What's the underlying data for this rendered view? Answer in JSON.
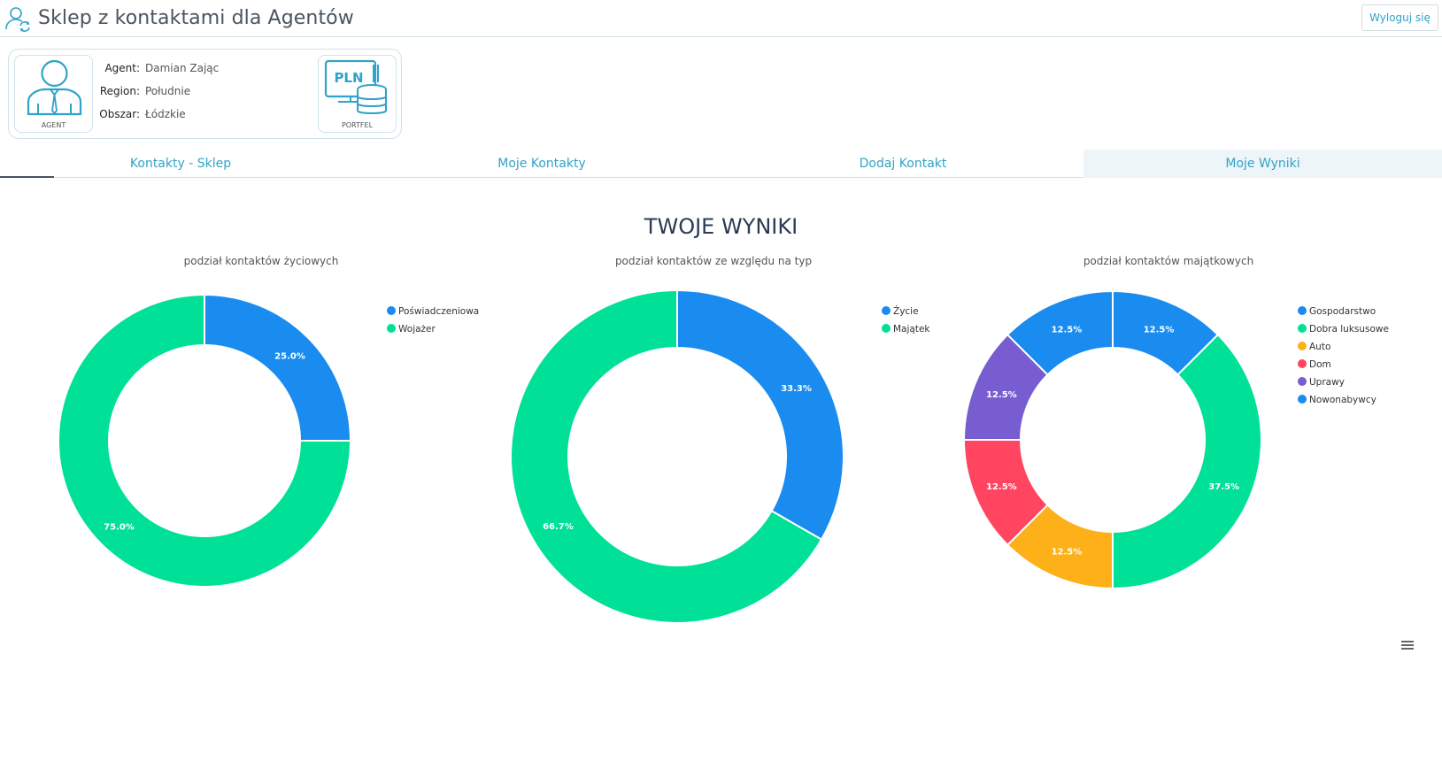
{
  "header": {
    "title": "Sklep z kontaktami dla Agentów",
    "logout_label": "Wyloguj się",
    "logo_icon": "user-sync-icon"
  },
  "agent_card": {
    "agent_tile_label": "AGENT",
    "wallet_tile_label": "PORTFEL",
    "wallet_currency": "PLN",
    "agent_icon": "person-icon",
    "wallet_icon": "wallet-coins-icon",
    "rows": [
      {
        "label": "Agent:",
        "value": "Damian Zając"
      },
      {
        "label": "Region:",
        "value": "Południe"
      },
      {
        "label": "Obszar:",
        "value": "Łódzkie"
      }
    ]
  },
  "tabs": [
    {
      "label": "Kontakty - Sklep",
      "active": false
    },
    {
      "label": "Moje Kontakty",
      "active": false
    },
    {
      "label": "Dodaj Kontakt",
      "active": false
    },
    {
      "label": "Moje Wyniki",
      "active": true
    }
  ],
  "section_title": "TWOJE WYNIKI",
  "menu_icon": "hamburger-menu-icon",
  "colors": {
    "accent": "#2fa3c9",
    "blue": "#1a8cf0",
    "green": "#00e096",
    "orange": "#feb019",
    "red": "#ff4560",
    "purple": "#775dd0"
  },
  "chart_data": [
    {
      "type": "pie",
      "variant": "donut",
      "title": "podział kontaktów życiowych",
      "categories": [
        "Poświadczeniowa",
        "Wojażer"
      ],
      "values": [
        25.0,
        75.0
      ],
      "labels": [
        "25.0%",
        "75.0%"
      ],
      "colors": [
        "#1a8cf0",
        "#00e096"
      ],
      "legend": "top-right"
    },
    {
      "type": "pie",
      "variant": "donut",
      "title": "podział kontaktów ze względu na typ",
      "categories": [
        "Życie",
        "Majątek"
      ],
      "values": [
        33.3,
        66.7
      ],
      "labels": [
        "33.3%",
        "66.7%"
      ],
      "colors": [
        "#1a8cf0",
        "#00e096"
      ],
      "legend": "top-right"
    },
    {
      "type": "pie",
      "variant": "donut",
      "title": "podział kontaktów majątkowych",
      "categories": [
        "Gospodarstwo",
        "Dobra luksusowe",
        "Auto",
        "Dom",
        "Uprawy",
        "Nowonabywcy"
      ],
      "values": [
        12.5,
        37.5,
        12.5,
        12.5,
        12.5,
        12.5
      ],
      "labels": [
        "12.5%",
        "37.5%",
        "12.5%",
        "12.5%",
        "12.5%",
        "12.5%"
      ],
      "colors": [
        "#1a8cf0",
        "#00e096",
        "#feb019",
        "#ff4560",
        "#775dd0",
        "#1a8cf0"
      ],
      "legend": "top-right"
    }
  ]
}
